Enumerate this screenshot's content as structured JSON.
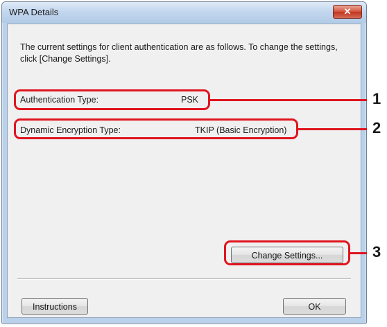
{
  "window": {
    "title": "WPA Details",
    "close_label": "✕"
  },
  "description": "The current settings for client authentication are as follows. To change the settings, click [Change Settings].",
  "fields": [
    {
      "label": "Authentication Type:",
      "value": "PSK"
    },
    {
      "label": "Dynamic Encryption Type:",
      "value": "TKIP (Basic Encryption)"
    }
  ],
  "buttons": {
    "change_settings": "Change Settings...",
    "instructions": "Instructions",
    "ok": "OK"
  },
  "callouts": [
    "1",
    "2",
    "3"
  ],
  "colors": {
    "highlight": "#e0141e",
    "title_bar": "#c3d7ee"
  }
}
